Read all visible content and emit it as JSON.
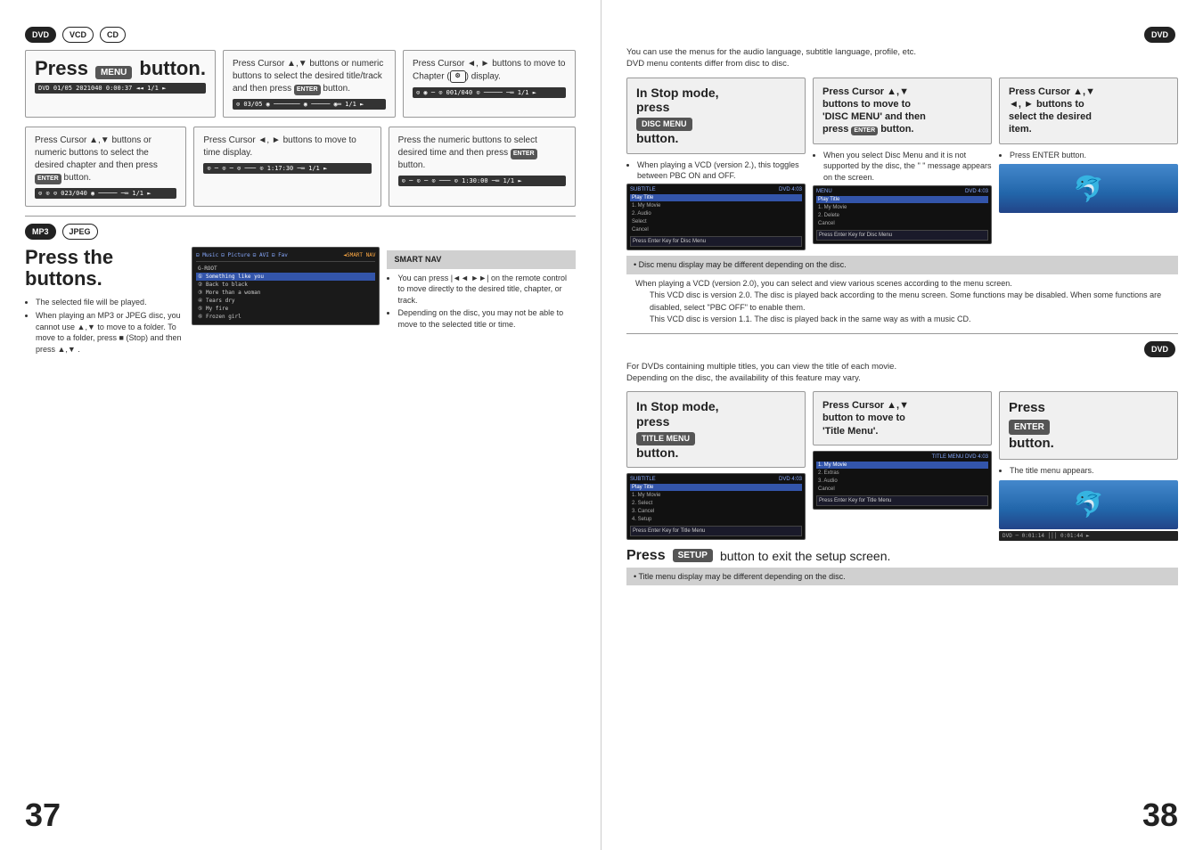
{
  "left_page": {
    "page_number": "37",
    "badges_top": [
      "DVD",
      "VCD",
      "CD"
    ],
    "section1": {
      "large_text": "Press",
      "large_text2": "button.",
      "status_bar": "DVD  01/05  2021040  0:00:37  ◄◄ 1/1 ►"
    },
    "section2": {
      "text": "Press Cursor ▲,▼ buttons or numeric buttons to select the desired title/track and then press",
      "text2": "button.",
      "status_bar": "⊙ 03/05 ◉ ─────── ◉ ───── ◉═ 1/1 ►"
    },
    "section3": {
      "text": "Press Cursor ◄, ► buttons to move to Chapter (",
      "chapter_icon": "⚙",
      "text2": ") display.",
      "status_bar": "⊙ ◉ ─ ⊙ 001/040 ⊙ ───── ─═ 1/1 ►"
    },
    "section4": {
      "text": "Press Cursor ▲,▼ buttons or numeric buttons to select the desired chapter and then press",
      "text2": "button.",
      "status_bar": "⊙ ⊙ ⊙ 023/040 ◉ ───── ─═ 1/1 ►"
    },
    "section5": {
      "text": "Press Cursor ◄, ► buttons to move to time display.",
      "status_bar": "⊙ ─ ⊙ ─ ⊙ ─── ⊙ 1:17:30 ─═ 1/1 ►"
    },
    "section6": {
      "text": "Press the numeric buttons to select desired time and then press",
      "text2": "button.",
      "status_bar": "⊙ ─ ⊙ ─ ⊙ ─── ⊙ 1:30:00 ─═ 1/1 ►"
    },
    "mp3_jpeg_section": {
      "badges": [
        "MP3",
        "JPEG"
      ],
      "title": "Press the buttons.",
      "bullets": [
        "The selected file will be played.",
        "When playing an MP3 or JPEG disc, you cannot use ▲,▼ to move to a folder. To move to a folder, press ■ (Stop) and then press ▲,▼ ."
      ],
      "file_list": {
        "toolbar": [
          "⊟ Music",
          "⊟ Picture",
          "⊟ AVI",
          "⊟ Fav"
        ],
        "folders": [
          "G-ROOT"
        ],
        "files": [
          "① Something like you",
          "② Back to black",
          "③ More than a woman",
          "④ Tears dry",
          "⑤ My fire",
          "⑥ Frozen girl"
        ],
        "selected_index": 0
      }
    },
    "smart_nav_section": {
      "badge_label": "SMART NAV",
      "bullets": [
        "You can press |◄◄ ►►| on the remote control to move directly to the desired title, chapter, or track.",
        "Depending on the disc, you may not be able to move to the selected title or time."
      ]
    }
  },
  "right_page": {
    "page_number": "38",
    "top_note_line1": "You can use the menus for the audio language, subtitle language, profile, etc.",
    "top_note_line2": "DVD menu contents differ from disc to disc.",
    "dvd_badge_top": "DVD",
    "section_stop_mode": {
      "col1": {
        "title_line1": "In Stop mode,",
        "title_line2": "press",
        "title_line3": "button.",
        "bullets": [
          "When playing a VCD (version 2.), this toggles between PBC ON and OFF."
        ],
        "screen": {
          "top_bar": "SUBTITLE  DVD 4:03",
          "items": [
            "Play Title",
            "1. My Movie",
            "2. Audio",
            "Select",
            "Cancel"
          ],
          "selected": 0,
          "msg": "Press Enter Key for Disc Menu"
        }
      },
      "col2": {
        "title_line1": "Press Cursor ▲,▼",
        "title_line2": "buttons to move to",
        "title_line3": "'DISC MENU' and then",
        "title_line4": "press",
        "title_line5": "button.",
        "bullets": [
          "When you select Disc Menu and it is not supported by the disc, the \" \" message appears on the screen."
        ],
        "screen": {
          "top_bar": "MENU  DVD 4:03",
          "items": [
            "Play Title",
            "1. My Movie",
            "2. Delete",
            "Cancel"
          ],
          "selected": 0,
          "msg": "Press Enter Key for Disc Menu"
        }
      },
      "col3": {
        "title_line1": "Press Cursor ▲,▼",
        "title_line2": "◄, ► buttons to",
        "title_line3": "select the desired",
        "title_line4": "item.",
        "bullets": [
          "Press ENTER button."
        ],
        "dolphin": true
      }
    },
    "note1": "• Disc menu display may be different depending on the disc.",
    "vcd_note": {
      "line1": "When playing a VCD (version 2.0), you can select and view various scenes according to the menu screen.",
      "line2": "This VCD disc is version 2.0. The disc is played back according to the menu screen. Some functions may be disabled. When some functions are disabled, select \"PBC OFF\" to enable them.",
      "line3": "This VCD disc is version 1.1. The disc is played back in the same way as with a music CD."
    },
    "dvd_badge_bottom": "DVD",
    "bottom_intro_line1": "For DVDs containing multiple titles, you can view the title of each movie.",
    "bottom_intro_line2": "Depending on the disc, the availability of this feature may vary.",
    "section_title_menu": {
      "col1": {
        "title_line1": "In Stop mode,",
        "title_line2": "press",
        "title_line3": "button.",
        "screen": {
          "top_bar": "SUBTITLE  DVD 4:03",
          "items": [
            "Play Title",
            "1. My Movie",
            "2. Select",
            "3. Cancel",
            "4. Setup"
          ],
          "selected": 0,
          "msg": "Press Enter Key for Title Menu"
        }
      },
      "col2": {
        "title_line1": "Press Cursor ▲,▼",
        "title_line2": "button to move to",
        "title_line3": "'Title Menu'.",
        "screen": {
          "top_bar": "TITLE MENU  DVD 4:03",
          "items": [
            "1. My Movie",
            "2. Extras",
            "3. Audio",
            "Cancel"
          ],
          "selected": 0,
          "msg": "Press Enter Key for Title Menu"
        }
      },
      "col3": {
        "title_line1": "Press",
        "title_line2": "button.",
        "bullets": [
          "The title menu appears."
        ],
        "dolphin": true,
        "player_bar": "DVD ─ 0:01:14 │││ 0:01:44 ►"
      }
    },
    "press_exit": {
      "press_label": "Press",
      "button_label": "button to exit the setup screen."
    },
    "bottom_note": "• Title menu display may be different depending on the disc."
  }
}
